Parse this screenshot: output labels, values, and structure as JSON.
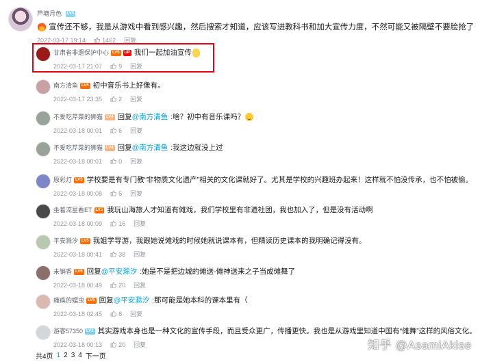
{
  "main_comment": {
    "username": "芦塘月色",
    "level": "LV5",
    "text": "宣传还不够，我是从游戏中看到感兴趣，然后搜索才知道，应该写进教科书和加大宣传力度，不然可能又被隔壁不要脸抢了",
    "time": "2022-03-17 19:14",
    "likes": "1462",
    "reply_label": "回复"
  },
  "replies": [
    {
      "username": "甘肃省非遗保护中心",
      "level": "LV5",
      "up": "UP",
      "reply_word": "",
      "at": "",
      "content": "我们一起加油宣传",
      "time": "2022-03-17 21:07",
      "likes": "9",
      "reply_label": "回复",
      "emoji": "hand-icon",
      "avatar_color": "#9b1b1b"
    },
    {
      "username": "南方清鱼",
      "level": "LV5",
      "reply_word": "",
      "at": "",
      "content": "初中音乐书上好像有。",
      "time": "2022-03-17 23:35",
      "likes": "2",
      "reply_label": "回复",
      "avatar_color": "#c7a1a6"
    },
    {
      "username": "不爱吃芹菜的狮猫",
      "level": "LV4",
      "reply_word": "回复",
      "at": "@南方清鱼",
      "content": ":啥？初中有音乐课吗？",
      "time": "2022-03-18 00:01",
      "likes": "6",
      "reply_label": "回复",
      "emoji": "smile-icon",
      "avatar_color": "#9aa39a"
    },
    {
      "username": "不爱吃芹菜的狮猫",
      "level": "LV4",
      "reply_word": "回复",
      "at": "@南方清鱼",
      "content": ":我这边就没上过",
      "time": "2022-03-18 00:01",
      "likes": "0",
      "reply_label": "回复",
      "avatar_color": "#9aa39a"
    },
    {
      "username": "原彩灯",
      "level": "LV5",
      "reply_word": "",
      "at": "",
      "content": "学校要是有专门教“非物质文化遗产”相关的文化课就好了。尤其是学校的兴趣班办起来！这样就不怕没传承，也不怕被偷。",
      "time": "2022-03-18 00:08",
      "likes": "5",
      "reply_label": "回复",
      "avatar_color": "#7d86c7"
    },
    {
      "username": "坐着流星看ET",
      "level": "LV5",
      "reply_word": "",
      "at": "",
      "content": "我玩山海旅人才知道有傩戏，我们学校里有非遗社团，我也加入了，但是没有活动啊",
      "time": "2022-03-18 00:09",
      "likes": "16",
      "reply_label": "回复",
      "avatar_color": "#4a4a4a"
    },
    {
      "username": "平安滁汐",
      "level": "LV5",
      "reply_word": "",
      "at": "",
      "content": "我姐学导游，我跟她说傩戏的时候她就说课本有，但精读历史课本的我明确记得没有。",
      "time": "2022-03-18 00:41",
      "likes": "38",
      "reply_label": "回复",
      "avatar_color": "#b9c9b0"
    },
    {
      "username": "未销香",
      "level": "LV5",
      "reply_word": "回复",
      "at": "@平安滁汐",
      "content": ":她是不是把边城的傩送-傩神送来之子当成傩舞了",
      "time": "2022-03-18 00:49",
      "likes": "20",
      "reply_label": "回复",
      "avatar_color": "#8a6f6a"
    },
    {
      "username": "瘫痪的蠕虫",
      "level": "LV5",
      "reply_word": "回复",
      "at": "@平安滁汐",
      "content": ":那可能是她本科的课本里有（",
      "time": "2022-03-18 02:45",
      "likes": "8",
      "reply_label": "回复",
      "avatar_color": "#d9b9b0"
    },
    {
      "username": "游客57350",
      "level": "LV3",
      "reply_word": "",
      "at": "",
      "content": "其实游戏本身也是一种文化的宣传手段，而且受众更广，传播更快。我也是从游戏里知道中国有“傩舞”这样的风俗文化。",
      "time": "2022-03-18 00:13",
      "likes": "20",
      "reply_label": "回复",
      "avatar_color": "#d3d6da"
    }
  ],
  "pagination": {
    "total": "共4页",
    "pages": [
      "1",
      "2",
      "3",
      "4"
    ],
    "current": "1",
    "next": "下一页"
  },
  "watermark": "知乎 @AsamiAkise",
  "colors": {
    "highlight_border": "#e60012",
    "link": "#00a1d6",
    "meta": "#9499a0"
  }
}
